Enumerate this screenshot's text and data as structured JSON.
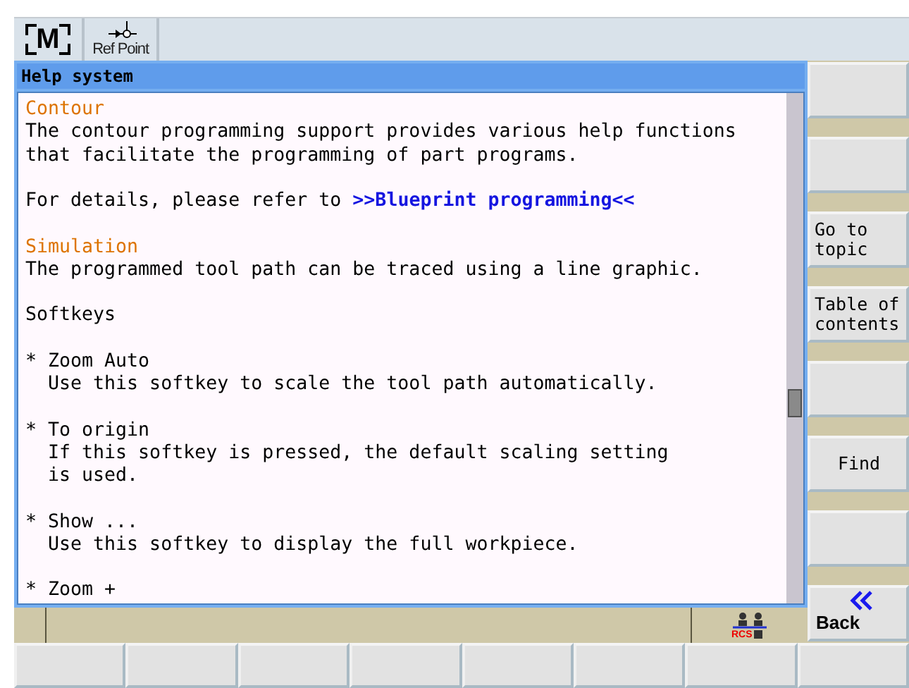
{
  "top_bar": {
    "buttons": [
      {
        "kind": "machine",
        "label": "M"
      },
      {
        "kind": "ref_point",
        "label": "Ref Point"
      }
    ]
  },
  "help_window": {
    "title": "Help system",
    "lines": [
      {
        "kind": "heading",
        "text": "Contour"
      },
      {
        "kind": "text",
        "text": "The contour programming support provides various help functions"
      },
      {
        "kind": "text",
        "text": "that facilitate the programming of part programs."
      },
      {
        "kind": "blank"
      },
      {
        "kind": "link_line",
        "text": "For details, please refer to ",
        "link": ">>Blueprint programming<<"
      },
      {
        "kind": "blank"
      },
      {
        "kind": "heading",
        "text": "Simulation"
      },
      {
        "kind": "text",
        "text": "The programmed tool path can be traced using a line graphic."
      },
      {
        "kind": "blank"
      },
      {
        "kind": "text",
        "text": "Softkeys"
      },
      {
        "kind": "blank"
      },
      {
        "kind": "text",
        "text": "* Zoom Auto"
      },
      {
        "kind": "text",
        "text": "  Use this softkey to scale the tool path automatically."
      },
      {
        "kind": "blank"
      },
      {
        "kind": "text",
        "text": "* To origin"
      },
      {
        "kind": "text",
        "text": "  If this softkey is pressed, the default scaling setting"
      },
      {
        "kind": "text",
        "text": "  is used."
      },
      {
        "kind": "blank"
      },
      {
        "kind": "text",
        "text": "* Show ..."
      },
      {
        "kind": "text",
        "text": "  Use this softkey to display the full workpiece."
      },
      {
        "kind": "blank"
      },
      {
        "kind": "text",
        "text": "* Zoom +"
      }
    ]
  },
  "vertical_softkeys": [
    {
      "kind": "empty"
    },
    {
      "kind": "empty"
    },
    {
      "kind": "label",
      "label": "Go to topic"
    },
    {
      "kind": "label",
      "label": "Table of contents"
    },
    {
      "kind": "empty"
    },
    {
      "kind": "centered_label",
      "label": "Find"
    },
    {
      "kind": "empty"
    },
    {
      "kind": "back",
      "label": "Back"
    }
  ],
  "status_bar": {
    "icon_label": "RCS"
  }
}
